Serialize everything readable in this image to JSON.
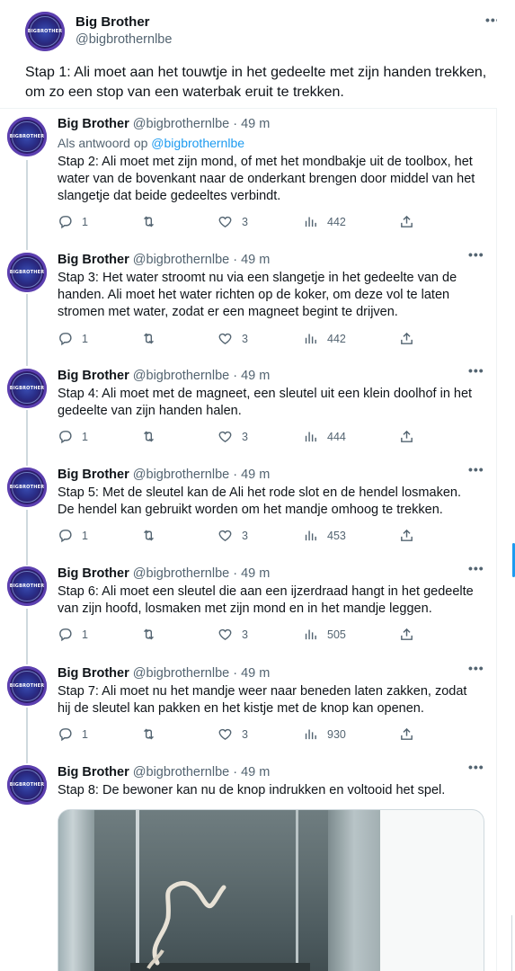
{
  "top_tweet": {
    "name": "Big Brother",
    "handle": "@bigbrothernlbe",
    "text": "Stap 1: Ali moet aan het touwtje in het gedeelte met zijn handen trekken, om zo een stop van een waterbak eruit te trekken.",
    "more_icon": "more-dots-icon"
  },
  "avatar_logo": "BIGBROTHER",
  "tweets": [
    {
      "name": "Big Brother",
      "handle": "@bigbrothernlbe",
      "time": "49 m",
      "reply_prefix": "Als antwoord op",
      "reply_handle": "@bigbrothernlbe",
      "text": "Stap 2: Ali moet met zijn mond, of met het mondbakje uit de toolbox, het water van de bovenkant naar de onderkant brengen door middel van het slangetje dat beide gedeeltes verbindt.",
      "replies": "1",
      "retweets": "",
      "likes": "3",
      "views": "442"
    },
    {
      "name": "Big Brother",
      "handle": "@bigbrothernlbe",
      "time": "49 m",
      "text": "Stap 3: Het water stroomt nu via een slangetje in het gedeelte van de handen. Ali moet het water richten op de koker, om deze vol te laten stromen met water, zodat er een magneet begint te drijven.",
      "replies": "1",
      "retweets": "",
      "likes": "3",
      "views": "442"
    },
    {
      "name": "Big Brother",
      "handle": "@bigbrothernlbe",
      "time": "49 m",
      "text": "Stap 4: Ali moet met de magneet, een sleutel uit een klein doolhof in het gedeelte van zijn handen halen.",
      "replies": "1",
      "retweets": "",
      "likes": "3",
      "views": "444"
    },
    {
      "name": "Big Brother",
      "handle": "@bigbrothernlbe",
      "time": "49 m",
      "text": "Stap 5: Met de sleutel kan de Ali het rode slot en de hendel losmaken. De hendel kan gebruikt worden om het mandje omhoog te trekken.",
      "replies": "1",
      "retweets": "",
      "likes": "3",
      "views": "453"
    },
    {
      "name": "Big Brother",
      "handle": "@bigbrothernlbe",
      "time": "49 m",
      "text": "Stap 6: Ali moet een sleutel die aan een ijzerdraad hangt in het gedeelte van zijn hoofd, losmaken met zijn mond en in het mandje leggen.",
      "replies": "1",
      "retweets": "",
      "likes": "3",
      "views": "505"
    },
    {
      "name": "Big Brother",
      "handle": "@bigbrothernlbe",
      "time": "49 m",
      "text": "Stap 7: Ali moet nu het mandje weer naar beneden laten zakken, zodat hij de sleutel kan pakken en het kistje met de knop kan openen.",
      "replies": "1",
      "retweets": "",
      "likes": "3",
      "views": "930"
    },
    {
      "name": "Big Brother",
      "handle": "@bigbrothernlbe",
      "time": "49 m",
      "text": "Stap 8: De bewoner kan nu de knop indrukken en voltooid het spel."
    }
  ],
  "colors": {
    "accent": "#1d9bf0",
    "muted": "#536471",
    "text": "#0f1419",
    "border": "#eff3f4"
  }
}
